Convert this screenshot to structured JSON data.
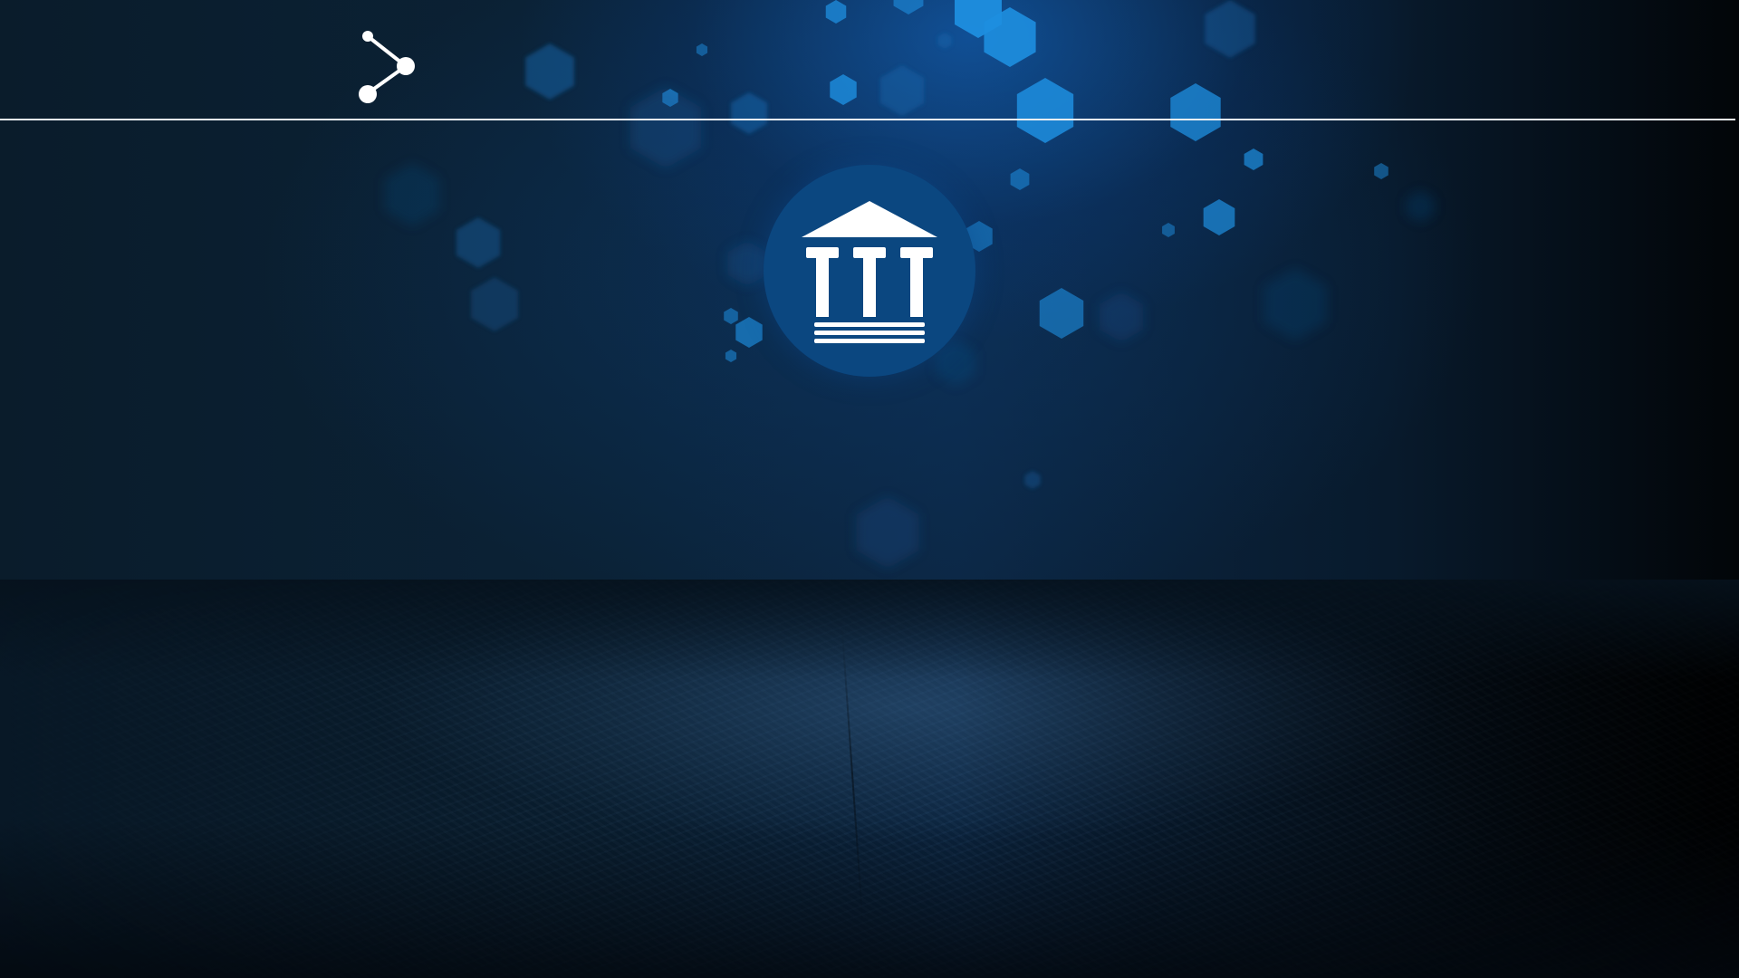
{
  "slide": {
    "icons": {
      "share": "share-icon",
      "institution": "bank-building-icon"
    },
    "colors": {
      "background": "#06121d",
      "accent_blue": "#0b4780",
      "hexagon_blue": "#1e8fe0",
      "rule": "#e9eef3"
    }
  }
}
